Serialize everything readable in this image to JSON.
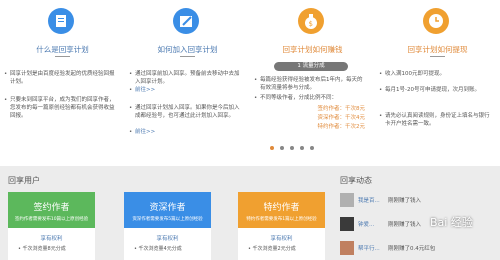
{
  "columns": [
    {
      "title": "什么是回享计划",
      "bullets": [
        "回享计划是由百度经验发起的优质经验回报计划。",
        "只要未到回享平台，成为我们的回享作者，您发布的每一篇原创经验都有机会获得收益回报。"
      ]
    },
    {
      "title": "如何加入回享计划",
      "bullets": [
        "通过回享前加入回享。预备前去移动中去加入回享计划。",
        "通过回享计划加入回享。如果你是今后加入成都经验号，也可通过此计划加入回享。"
      ],
      "links": [
        "前往>>",
        "前往>>"
      ]
    },
    {
      "title": "回享计划如何赚钱",
      "pill": "1 流量分成",
      "bullets": [
        "每篇经验获得经验被发布后1年内，每天的有效流量将参与分成。",
        "不同等级作者，分成比例不同："
      ],
      "rates": [
        "签约作者：千次8元",
        "资深作者：千次4元",
        "特约作者：千次2元"
      ]
    },
    {
      "title": "回享计划如何提现",
      "bullets": [
        "收入满100元即可提现。",
        "每月1号-20号可申请提现，次月到账。",
        "请先必认真阅读规则，身份证上填名与银行卡开户姓名需一致。"
      ]
    }
  ],
  "sections": {
    "left": "回享用户",
    "right": "回享动态"
  },
  "cards": [
    {
      "title": "签约作者",
      "desc": "签约作者需要发布10篇以上原创经验",
      "priv": "享有权利",
      "line": "• 千次浏览量8元分成",
      "color": "#5cb85c"
    },
    {
      "title": "资深作者",
      "desc": "资深作者需要发布5篇以上原创经验",
      "priv": "享有权利",
      "line": "• 千次浏览量4元分成",
      "color": "#3a8ee6"
    },
    {
      "title": "特约作者",
      "desc": "特约作者需要发布1篇以上原创经验",
      "priv": "享有权利",
      "line": "• 千次浏览量2元分成",
      "color": "#f0a030"
    }
  ],
  "feed": [
    {
      "name": "我是百...",
      "text": "刚刚赚了钱入"
    },
    {
      "name": "钟爱...",
      "text": "刚刚赚了钱入"
    },
    {
      "name": "帮平行...",
      "text": "刚刚赚了0.4元红包"
    }
  ],
  "watermark": "Bai 经验",
  "colors": {
    "blue": "#4a78b0",
    "orange": "#e08a3a"
  }
}
